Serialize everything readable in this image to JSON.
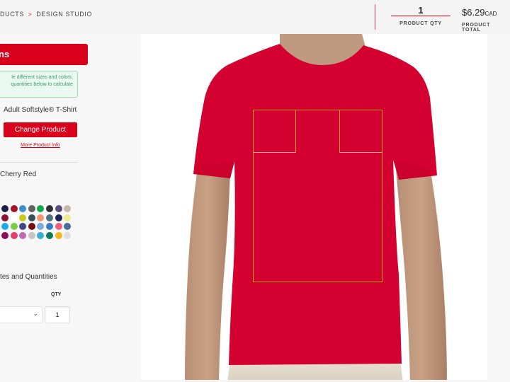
{
  "header": {
    "breadcrumb": [
      {
        "label": "DUCTS"
      },
      {
        "label": "DESIGN STUDIO"
      }
    ],
    "breadcrumb_separator": ">",
    "product_qty": "1",
    "product_qty_label": "PRODUCT QTY",
    "product_total": "$6.29",
    "product_total_currency": "CAD",
    "product_total_label": "PRODUCT TOTAL"
  },
  "left_panel": {
    "title": "ns",
    "info_lines": [
      "le different sizes and colors.",
      "quantities below to calculate"
    ],
    "product_name": "Adult Softstyle® T-Shirt",
    "change_product_label": "Change Product",
    "more_info_label": "More Product Info",
    "selected_color": "Cherry Red",
    "swatches": [
      {
        "color": "#1c1f4a"
      },
      {
        "color": "#a5122a"
      },
      {
        "color": "#3d8fd1"
      },
      {
        "color": "#5f6062"
      },
      {
        "color": "#0fa84a"
      },
      {
        "color": "#2f3338"
      },
      {
        "color": "#5a4a7e"
      },
      {
        "color": "#c9b7a7"
      },
      {
        "color": "#8c1130"
      },
      {
        "color": "#ffffff"
      },
      {
        "color": "#c4cb1c"
      },
      {
        "color": "#3d4d5c"
      },
      {
        "color": "#f59670"
      },
      {
        "color": "#4c7283"
      },
      {
        "color": "#1e2356"
      },
      {
        "color": "#f3eb8f"
      },
      {
        "color": "#1aaee8"
      },
      {
        "color": "#7acc45"
      },
      {
        "color": "#3d4682"
      },
      {
        "color": "#7a0a12"
      },
      {
        "color": "#7ea9de"
      },
      {
        "color": "#3a7acb"
      },
      {
        "color": "#f55d80"
      },
      {
        "color": "#4a6a9a"
      },
      {
        "color": "#8b0d55"
      },
      {
        "color": "#e0406a"
      },
      {
        "color": "#c06ab4"
      },
      {
        "color": "#c4c4c4"
      },
      {
        "color": "#3aaed0"
      },
      {
        "color": "#0d7a5a"
      },
      {
        "color": "#f5b51c"
      },
      {
        "color": "#dedede"
      }
    ],
    "sizes_title": "tes and Quantities",
    "qty_column_label": "QTY",
    "size_select_value": "",
    "qty_value": "1"
  },
  "canvas": {
    "shirt_color": "#d4002f",
    "design_area_color": "#f3a51c"
  }
}
